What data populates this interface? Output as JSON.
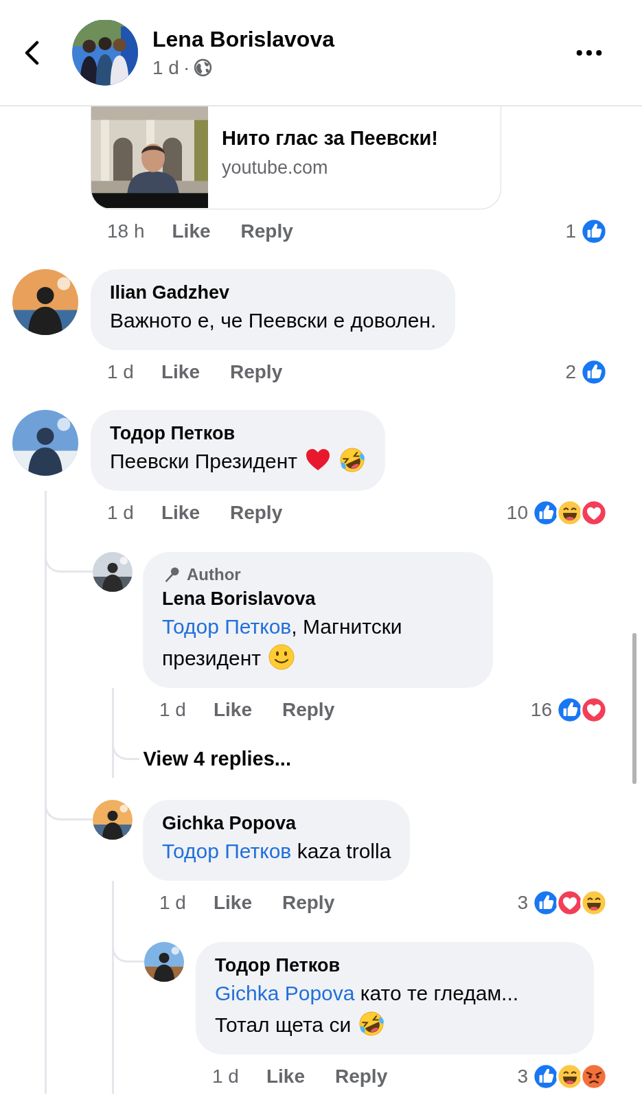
{
  "header": {
    "name": "Lena Borislavova",
    "time": "1 d",
    "separator": "·",
    "avatar": {
      "kind": "picture"
    }
  },
  "comments": [
    {
      "attachment": {
        "kind": "link",
        "title": "Нито глас за Пеевски!",
        "domain": "youtube.com"
      },
      "time": "18 h",
      "like": "Like",
      "reply": "Reply",
      "reaction_count": "1",
      "reactions": [
        {
          "kind": "like"
        }
      ]
    },
    {
      "avatar": {
        "kind": "picture"
      },
      "name": "Ilian Gadzhev",
      "text": "Важното е, че Пеевски е доволен.",
      "time": "1 d",
      "like": "Like",
      "reply": "Reply",
      "reaction_count": "2",
      "reactions": [
        {
          "kind": "like"
        }
      ]
    },
    {
      "avatar": {
        "kind": "picture"
      },
      "name": "Тодор Петков",
      "text": "Пеевски Президент",
      "emojis": [
        {
          "kind": "heart"
        },
        {
          "kind": "rofl"
        }
      ],
      "time": "1 d",
      "like": "Like",
      "reply": "Reply",
      "reaction_count": "10",
      "reactions": [
        {
          "kind": "like"
        },
        {
          "kind": "haha"
        },
        {
          "kind": "love"
        }
      ],
      "children": [
        {
          "avatar": {
            "kind": "picture"
          },
          "badge": "Author",
          "name": "Lena Borislavova",
          "mention": "Тодор Петков",
          "text": ", Магнитски президент",
          "emojis": [
            {
              "kind": "smile"
            }
          ],
          "time": "1 d",
          "like": "Like",
          "reply": "Reply",
          "reaction_count": "16",
          "reactions": [
            {
              "kind": "like"
            },
            {
              "kind": "love"
            }
          ],
          "view_replies": "View 4 replies..."
        },
        {
          "avatar": {
            "kind": "picture"
          },
          "name": "Gichka Popova",
          "mention": "Тодор Петков",
          "text": " kaza trolla",
          "time": "1 d",
          "like": "Like",
          "reply": "Reply",
          "reaction_count": "3",
          "reactions": [
            {
              "kind": "like"
            },
            {
              "kind": "love"
            },
            {
              "kind": "haha"
            }
          ],
          "children": [
            {
              "avatar": {
                "kind": "picture"
              },
              "name": "Тодор Петков",
              "mention": "Gichka Popova",
              "text": " като те гледам... Тотал щета си",
              "emojis": [
                {
                  "kind": "rofl"
                }
              ],
              "time": "1 d",
              "like": "Like",
              "reply": "Reply",
              "reaction_count": "3",
              "reactions": [
                {
                  "kind": "like"
                },
                {
                  "kind": "haha"
                },
                {
                  "kind": "angry"
                }
              ]
            }
          ]
        }
      ]
    }
  ]
}
